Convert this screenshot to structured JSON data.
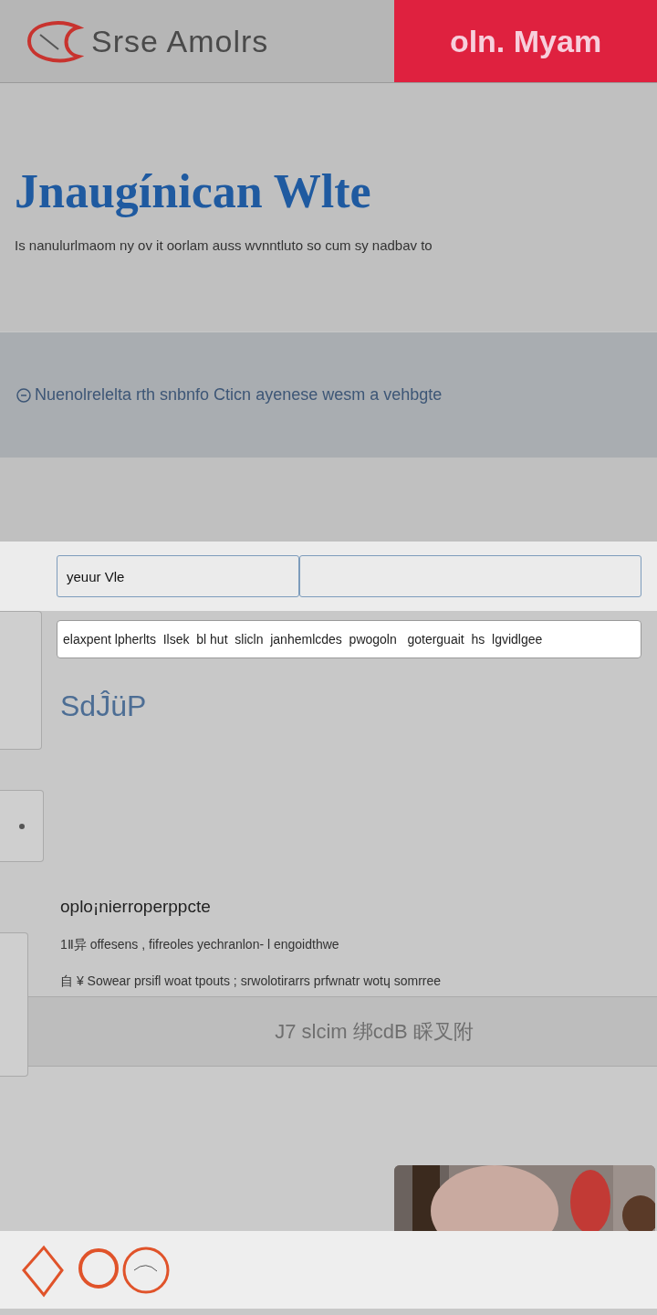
{
  "header": {
    "brand": "Srse Amolrs",
    "action": "oln. Myam"
  },
  "hero": {
    "title": "Jnaugínican Wlte",
    "subtitle": "Is nanulurlmaom ny ov it oorlam auss wvnntluto so cum sy nadbav to"
  },
  "notice": {
    "text": "Nuenolrelelta rth snbnfo  Cticn ayenese wesm a vehbgte"
  },
  "form": {
    "fields": [
      {
        "value": "yeuur Vle"
      }
    ],
    "search": {
      "value": "elaxpent lpherlts  Ilsek  bl hut  slicln  janhemlcdes  pwogoln   goterguait  hs  lgvidlgee"
    }
  },
  "section": {
    "title": "SdĴüP",
    "heading": "oplo¡nierroperppcte",
    "lines": [
      "1Ⅱ异  offesens  ,  fifreoles yechranlon- l engoidthwe",
      "自 ¥  Sowear prsifl woat tpouts ; srwolotirarrs prfwnatr wotɥ somrree"
    ]
  },
  "bar": {
    "text": "J7 slcim 绑cdB   睬叉附"
  }
}
